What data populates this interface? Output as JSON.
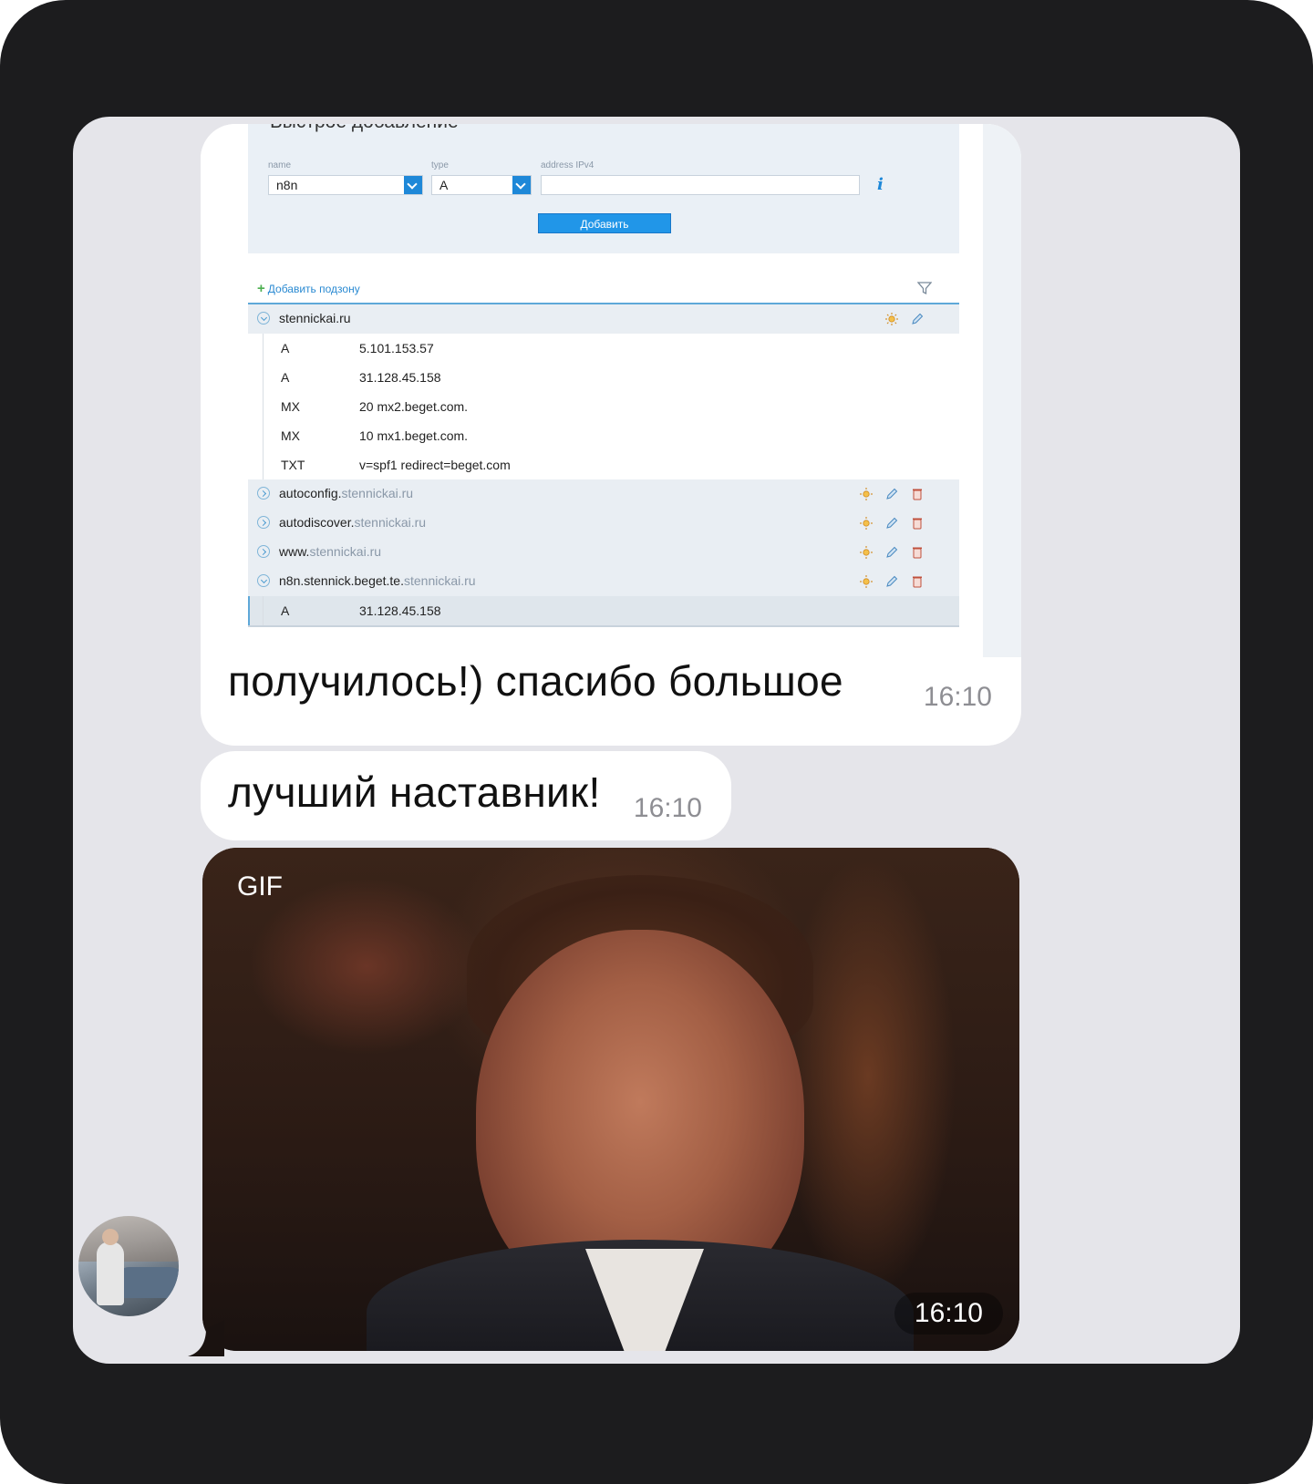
{
  "screenshot": {
    "panel_title": "Быстрое добавление",
    "fields": {
      "name_label": "name",
      "name_value": "n8n",
      "type_label": "type",
      "type_value": "A",
      "address_label": "address IPv4",
      "address_value": ""
    },
    "add_button": "Добавить",
    "add_subzone": "Добавить подзону",
    "zones": [
      {
        "name": "stennickai.ru",
        "domain": "",
        "expanded": true
      },
      {
        "name": "autoconfig.",
        "domain": "stennickai.ru",
        "expanded": false
      },
      {
        "name": "autodiscover.",
        "domain": "stennickai.ru",
        "expanded": false
      },
      {
        "name": "www.",
        "domain": "stennickai.ru",
        "expanded": false
      },
      {
        "name": "n8n.stennick.beget.te.",
        "domain": "stennickai.ru",
        "expanded": true
      }
    ],
    "records_main": [
      {
        "type": "A",
        "value": "5.101.153.57"
      },
      {
        "type": "A",
        "value": "31.128.45.158"
      },
      {
        "type": "MX",
        "value": "20 mx2.beget.com."
      },
      {
        "type": "MX",
        "value": "10 mx1.beget.com."
      },
      {
        "type": "TXT",
        "value": "v=spf1 redirect=beget.com"
      }
    ],
    "records_n8n": [
      {
        "type": "A",
        "value": "31.128.45.158"
      }
    ]
  },
  "messages": [
    {
      "text": "получилось!) спасибо большое",
      "time": "16:10"
    },
    {
      "text": "лучший наставник!",
      "time": "16:10"
    },
    {
      "gif_label": "GIF",
      "time": "16:10"
    }
  ],
  "colors": {
    "chat_bg": "#e5e5ea",
    "bubble": "#ffffff",
    "accent": "#2196e8",
    "device": "#1c1c1e"
  },
  "icons": [
    "chevron-down-icon",
    "chevron-right-icon",
    "sun-icon",
    "pencil-icon",
    "trash-icon",
    "filter-icon",
    "info-icon",
    "plus-icon"
  ]
}
